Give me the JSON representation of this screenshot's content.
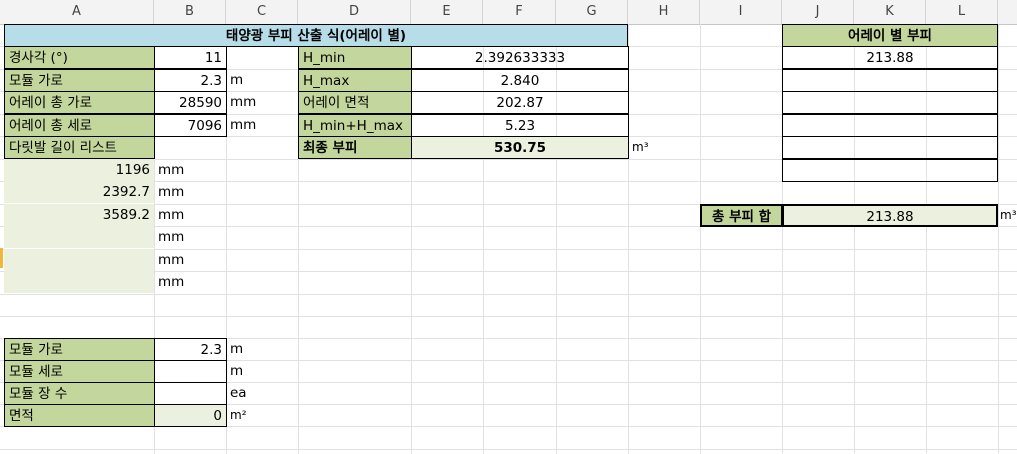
{
  "columns": [
    "A",
    "B",
    "C",
    "D",
    "E",
    "F",
    "G",
    "H",
    "I",
    "J",
    "K",
    "L"
  ],
  "title": "태양광 부피 산출 식(어레이 별)",
  "inputs": [
    {
      "label": "경사각 (°)",
      "value": "11",
      "unit": ""
    },
    {
      "label": "모듈 가로",
      "value": "2.3",
      "unit": "m"
    },
    {
      "label": "어레이 총 가로",
      "value": "28590",
      "unit": "mm"
    },
    {
      "label": "어레이 총 세로",
      "value": "7096",
      "unit": "mm"
    },
    {
      "label": "다릿발 길이 리스트",
      "value": "",
      "unit": ""
    }
  ],
  "leg_list": [
    {
      "value": "1196",
      "unit": "mm"
    },
    {
      "value": "2392.7",
      "unit": "mm"
    },
    {
      "value": "3589.2",
      "unit": "mm"
    },
    {
      "value": "",
      "unit": "mm"
    },
    {
      "value": "",
      "unit": "mm"
    },
    {
      "value": "",
      "unit": "mm"
    }
  ],
  "calc": [
    {
      "label": "H_min",
      "value": "2.392633333"
    },
    {
      "label": "H_max",
      "value": "2.840"
    },
    {
      "label": "어레이 면적",
      "value": "202.87"
    },
    {
      "label": "H_min+H_max",
      "value": "5.23"
    }
  ],
  "final": {
    "label": "최종 부피",
    "value": "530.75",
    "unit": "m³"
  },
  "array_volume": {
    "header": "어레이 별 부피",
    "values": [
      "213.88",
      "",
      "",
      "",
      "",
      ""
    ],
    "total_label": "총 부피 합",
    "total_value": "213.88",
    "total_unit": "m³"
  },
  "module": [
    {
      "label": "모듈 가로",
      "value": "2.3",
      "unit": "m"
    },
    {
      "label": "모듈 세로",
      "value": "",
      "unit": "m"
    },
    {
      "label": "모듈 장 수",
      "value": "",
      "unit": "ea"
    },
    {
      "label": "면적",
      "value": "0",
      "unit": "m²"
    }
  ]
}
